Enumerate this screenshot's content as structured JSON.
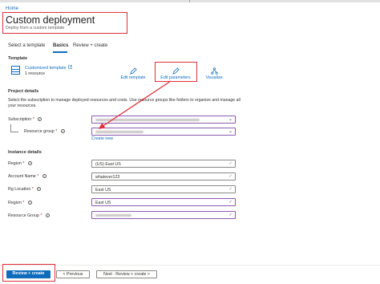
{
  "breadcrumb": {
    "home": "Home"
  },
  "header": {
    "title": "Custom deployment",
    "more": "···",
    "subtitle": "Deploy from a custom template"
  },
  "tabs": [
    {
      "label": "Select a template",
      "active": false
    },
    {
      "label": "Basics",
      "active": true
    },
    {
      "label": "Review + create",
      "active": false
    }
  ],
  "template": {
    "heading": "Template",
    "link": "Customized template",
    "link_icon": "external-link-icon",
    "resources": "1 resource",
    "actions": {
      "edit_template": "Edit template",
      "edit_parameters": "Edit parameters",
      "visualize": "Visualize"
    }
  },
  "project": {
    "heading": "Project details",
    "description": "Select the subscription to manage deployed resources and costs. Use resource groups like folders to organize and manage all your resources.",
    "subscription_label": "Subscription",
    "resource_group_label": "Resource group",
    "create_new": "Create new"
  },
  "instance": {
    "heading": "Instance details",
    "region_label": "Region",
    "region_value": "(US) East US",
    "account_name_label": "Account Name",
    "account_name_value": "whatever123",
    "rg_location_label": "Rg Location",
    "rg_location_value": "East US",
    "region2_label": "Region",
    "region2_value": "East US",
    "resource_group_label": "Resource Group"
  },
  "required_mark": "*",
  "info_glyph": "i",
  "footer": {
    "review_create": "Review + create",
    "previous": "< Previous",
    "next": "Next : Review + create >"
  },
  "colors": {
    "accent": "#0f6cbd",
    "highlight": "#e0303a",
    "focus_border": "#8a5ab0"
  }
}
